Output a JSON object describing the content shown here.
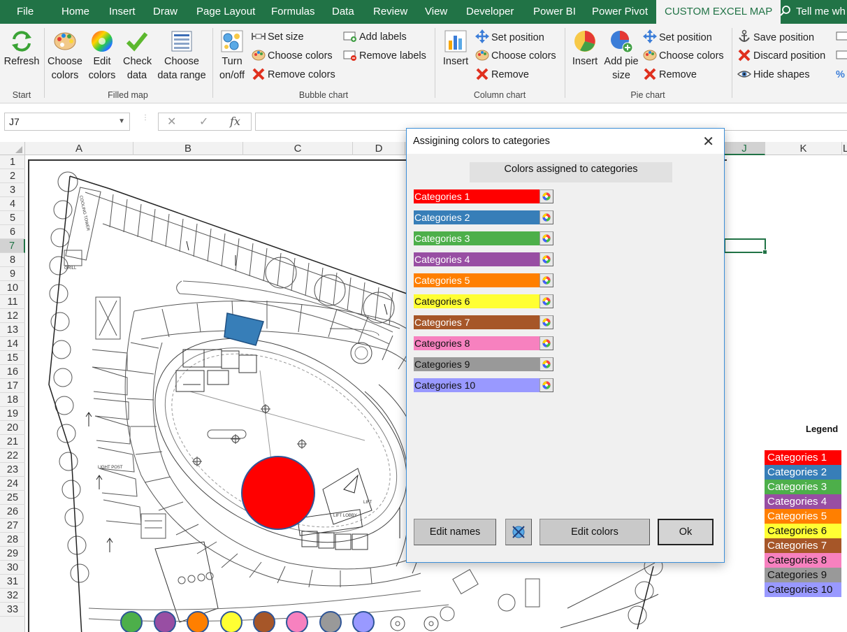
{
  "tabs": [
    {
      "label": "File"
    },
    {
      "label": "Home"
    },
    {
      "label": "Insert"
    },
    {
      "label": "Draw"
    },
    {
      "label": "Page Layout"
    },
    {
      "label": "Formulas"
    },
    {
      "label": "Data"
    },
    {
      "label": "Review"
    },
    {
      "label": "View"
    },
    {
      "label": "Developer"
    },
    {
      "label": "Power BI"
    },
    {
      "label": "Power Pivot"
    },
    {
      "label": "CUSTOM EXCEL MAP"
    }
  ],
  "tell_me": "Tell me wh",
  "ribbon": {
    "start": {
      "refresh": "Refresh",
      "group": "Start"
    },
    "filled_map": {
      "choose_colors": "Choose colors",
      "edit_colors": "Edit colors",
      "check_data": "Check data",
      "choose_range": "Choose data range",
      "group": "Filled map"
    },
    "bubble_chart": {
      "turn": "Turn on/off",
      "set_size": "Set size",
      "choose_colors": "Choose colors",
      "remove_colors": "Remove colors",
      "add_labels": "Add labels",
      "remove_labels": "Remove labels",
      "group": "Bubble chart"
    },
    "column_chart": {
      "insert": "Insert",
      "set_position": "Set position",
      "choose_colors": "Choose colors",
      "remove": "Remove",
      "group": "Column chart"
    },
    "pie_chart": {
      "insert": "Insert",
      "add_pie_size": "Add pie size",
      "set_position": "Set position",
      "choose_colors": "Choose colors",
      "remove": "Remove",
      "group": "Pie chart"
    },
    "shapes": {
      "save_position": "Save position",
      "discard_position": "Discard position",
      "hide_shapes": "Hide shapes"
    }
  },
  "formula_bar": {
    "name_box": "J7",
    "fx": "fx"
  },
  "columns": [
    "A",
    "B",
    "C",
    "D",
    "J",
    "K",
    "L"
  ],
  "rows": [
    "1",
    "2",
    "3",
    "4",
    "5",
    "6",
    "7",
    "8",
    "9",
    "10",
    "11",
    "12",
    "13",
    "14",
    "15",
    "16",
    "17",
    "18",
    "19",
    "20",
    "21",
    "22",
    "23",
    "24",
    "25",
    "26",
    "27",
    "28",
    "29",
    "30",
    "31",
    "32",
    "33"
  ],
  "legend": {
    "title": "Legend",
    "items": [
      "Categories 1",
      "Categories 2",
      "Categories 3",
      "Categories 4",
      "Categories 5",
      "Categories 6",
      "Categories 7",
      "Categories 8",
      "Categories 9",
      "Categories 10"
    ]
  },
  "dialog": {
    "title": "Assigining colors to categories",
    "header": "Colors assigned to categories",
    "categories": [
      {
        "label": "Categories 1",
        "color": "#ff0000"
      },
      {
        "label": "Categories 2",
        "color": "#377eb8"
      },
      {
        "label": "Categories 3",
        "color": "#4daf4a"
      },
      {
        "label": "Categories 4",
        "color": "#984ea3"
      },
      {
        "label": "Categories 5",
        "color": "#ff7f00"
      },
      {
        "label": "Categories 6",
        "color": "#ffff33"
      },
      {
        "label": "Categories 7",
        "color": "#a65628"
      },
      {
        "label": "Categories 8",
        "color": "#f781bf"
      },
      {
        "label": "Categories 9",
        "color": "#999999"
      },
      {
        "label": "Categories 10",
        "color": "#9999ff"
      }
    ],
    "buttons": {
      "edit_names": "Edit names",
      "edit_colors": "Edit colors",
      "ok": "Ok"
    }
  },
  "plan_labels": {
    "cooling_tower": "COOLING TOWER",
    "grill": "GRILL",
    "light_post": "LIGHT POST",
    "lift": "LIFT",
    "lift_lobby": "LIFT LOBBY"
  },
  "icons": [
    "refresh-icon",
    "palette-icon",
    "color-wheel-icon",
    "checkmark-icon",
    "data-range-icon",
    "bubbles-icon",
    "ruler-icon",
    "red-x-icon",
    "add-label-icon",
    "remove-label-icon",
    "column-chart-icon",
    "move-icon",
    "pie-chart-icon",
    "add-pie-icon",
    "anchor-icon",
    "eye-icon",
    "search-icon",
    "close-icon",
    "eraser-icon"
  ]
}
